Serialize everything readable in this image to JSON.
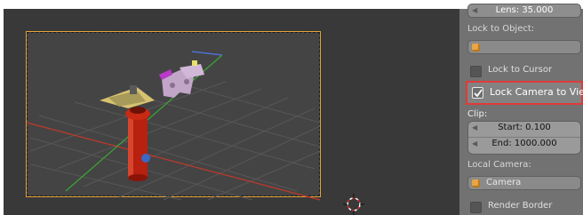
{
  "properties_panel": {
    "lens_label": "Lens: 35.000",
    "lock_to_object_label": "Lock to Object:",
    "lock_to_cursor_label": "Lock to Cursor",
    "lock_to_cursor_checked": false,
    "lock_camera_to_view_label": "Lock Camera to View",
    "lock_camera_to_view_checked": true,
    "clip_label": "Clip:",
    "clip_start_label": "Start: 0.100",
    "clip_end_label": "End: 1000.000",
    "local_camera_label": "Local Camera:",
    "local_camera_value": "Camera",
    "render_border_label": "Render Border",
    "render_border_checked": false,
    "highlight_color": "#e03a3a"
  },
  "viewport": {
    "background_color": "#393939",
    "camera_frame_color": "#e8a338",
    "axis_x_color": "#c0392b",
    "axis_y_color": "#3aa635"
  }
}
